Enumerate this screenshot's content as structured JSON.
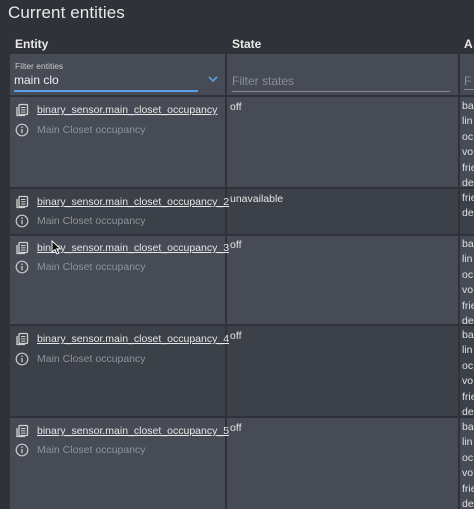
{
  "title": "Current entities",
  "columns": {
    "entity": "Entity",
    "state": "State",
    "attributes": "A"
  },
  "filters": {
    "entity_label": "Filter entities",
    "entity_value": "main clo",
    "state_placeholder": "Filter states",
    "attributes_placeholder": "F"
  },
  "rows": [
    {
      "entity_id": "binary_sensor.main_closet_occupancy",
      "friendly_name": "Main Closet occupancy",
      "state": "off",
      "attr_lines": [
        "ba",
        "lin",
        "oc",
        "vo",
        "frie",
        "de"
      ]
    },
    {
      "entity_id": "binary_sensor.main_closet_occupancy_2",
      "friendly_name": "Main Closet occupancy",
      "state": "unavailable",
      "attr_lines": [
        "frie",
        "de"
      ]
    },
    {
      "entity_id": "binary_sensor.main_closet_occupancy_3",
      "friendly_name": "Main Closet occupancy",
      "state": "off",
      "attr_lines": [
        "ba",
        "lin",
        "oc",
        "vo",
        "frie",
        "de"
      ]
    },
    {
      "entity_id": "binary_sensor.main_closet_occupancy_4",
      "friendly_name": "Main Closet occupancy",
      "state": "off",
      "attr_lines": [
        "ba",
        "lin",
        "oc",
        "vo",
        "frie",
        "de"
      ]
    },
    {
      "entity_id": "binary_sensor.main_closet_occupancy_5",
      "friendly_name": "Main Closet occupancy",
      "state": "off",
      "attr_lines": [
        "ba",
        "lin",
        "oc",
        "vo",
        "frie",
        "de"
      ]
    }
  ],
  "icons": {
    "copy": "clipboard-copy-icon",
    "info": "info-circle-icon",
    "dropdown": "chevron-down-icon",
    "cursor": "mouse-pointer-icon"
  },
  "colors": {
    "background": "#2f3238",
    "row_light": "#464b55",
    "row_dark": "#3c4048",
    "accent": "#5aa0e8",
    "spellcheck": "#e53935"
  }
}
